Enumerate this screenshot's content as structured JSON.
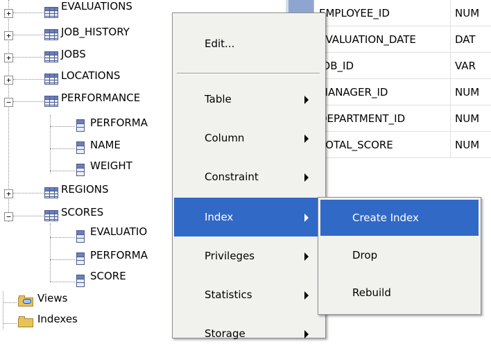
{
  "tree": {
    "tables": [
      {
        "name": "EVALUATIONS",
        "expanded": false
      },
      {
        "name": "JOB_HISTORY",
        "expanded": false
      },
      {
        "name": "JOBS",
        "expanded": false
      },
      {
        "name": "LOCATIONS",
        "expanded": false
      },
      {
        "name": "PERFORMANCE",
        "expanded": true
      },
      {
        "name": "REGIONS",
        "expanded": false
      },
      {
        "name": "SCORES",
        "expanded": true
      }
    ],
    "performance_columns": [
      "PERFORMA",
      "NAME",
      "WEIGHT"
    ],
    "scores_columns": [
      "EVALUATIO",
      "PERFORMA",
      "SCORE"
    ],
    "folders": [
      "Views",
      "Indexes"
    ],
    "expand_glyph": "+",
    "collapse_glyph": "−"
  },
  "grid": {
    "rows": [
      {
        "name": "EMPLOYEE_ID",
        "type": "NUM"
      },
      {
        "name": "EVALUATION_DATE",
        "type": "DAT"
      },
      {
        "name": "JOB_ID",
        "type": "VAR"
      },
      {
        "name": "MANAGER_ID",
        "type": "NUM"
      },
      {
        "name": "DEPARTMENT_ID",
        "type": "NUM"
      },
      {
        "name": "TOTAL_SCORE",
        "type": "NUM"
      }
    ]
  },
  "context_menu": {
    "items": [
      {
        "label": "Edit...",
        "has_submenu": false
      },
      {
        "label": "Table",
        "has_submenu": true
      },
      {
        "label": "Column",
        "has_submenu": true
      },
      {
        "label": "Constraint",
        "has_submenu": true
      },
      {
        "label": "Index",
        "has_submenu": true,
        "active": true
      },
      {
        "label": "Privileges",
        "has_submenu": true
      },
      {
        "label": "Statistics",
        "has_submenu": true
      },
      {
        "label": "Storage",
        "has_submenu": true
      }
    ]
  },
  "submenu": {
    "items": [
      {
        "label": "Create Index",
        "active": true
      },
      {
        "label": "Drop",
        "active": false
      },
      {
        "label": "Rebuild",
        "active": false
      }
    ]
  },
  "colors": {
    "menu_background": "#f1f1ee",
    "highlight": "#3169c6",
    "highlight_text": "#ffffff",
    "grid_marker": "#d6dde8"
  }
}
